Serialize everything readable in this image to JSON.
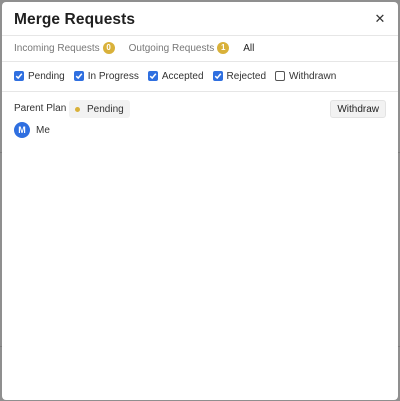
{
  "dialog": {
    "title": "Merge Requests",
    "close_icon": "close-icon"
  },
  "tabs": [
    {
      "label": "Incoming Requests",
      "badge": "0",
      "active": false
    },
    {
      "label": "Outgoing Requests",
      "badge": "1",
      "active": false
    },
    {
      "label": "All",
      "badge": null,
      "active": true
    }
  ],
  "filters": [
    {
      "label": "Pending",
      "checked": true
    },
    {
      "label": "In Progress",
      "checked": true
    },
    {
      "label": "Accepted",
      "checked": true
    },
    {
      "label": "Rejected",
      "checked": true
    },
    {
      "label": "Withdrawn",
      "checked": false
    }
  ],
  "requests": [
    {
      "plan": "Parent Plan",
      "status": "Pending",
      "action_label": "Withdraw",
      "author_initial": "M",
      "author_name": "Me"
    }
  ],
  "colors": {
    "accent": "#2f6fe0",
    "badge": "#d9b13a",
    "status_pending": "#d9b13a"
  }
}
